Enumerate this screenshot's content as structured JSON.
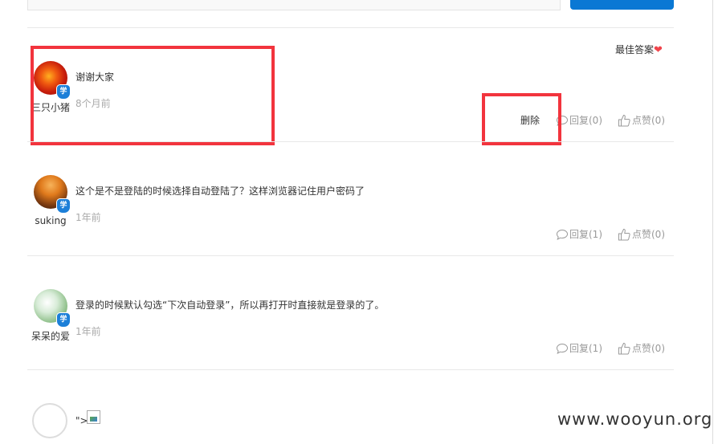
{
  "header": {
    "search_value": "",
    "submit_label": ""
  },
  "best_answer_label": "最佳答案",
  "answers": [
    {
      "username": "三只小猪",
      "text": "谢谢大家",
      "time": "8个月前",
      "delete_label": "删除",
      "reply_label": "回复(0)",
      "like_label": "点赞(0)",
      "badge": "学"
    },
    {
      "username": "suking",
      "text": "这个是不是登陆的时候选择自动登陆了？这样浏览器记住用户密码了",
      "time": "1年前",
      "reply_label": "回复(1)",
      "like_label": "点赞(0)",
      "badge": "学"
    },
    {
      "username": "呆呆的爱",
      "text": "登录的时候默认勾选“下次自动登录”，所以再打开时直接就是登录的了。",
      "time": "1年前",
      "reply_label": "回复(1)",
      "like_label": "点赞(0)",
      "badge": "学"
    },
    {
      "text": "\">",
      "image_alt": ""
    }
  ],
  "watermark": "www.wooyun.org",
  "colors": {
    "highlight_box": "#f2343d",
    "badge": "#1c7fd8",
    "heart": "#f0444b",
    "button": "#0a78d4"
  },
  "icons": {
    "reply": "speech-bubble-icon",
    "like": "thumbs-up-icon",
    "heart": "heart-icon",
    "badge": "student-shield-icon"
  }
}
